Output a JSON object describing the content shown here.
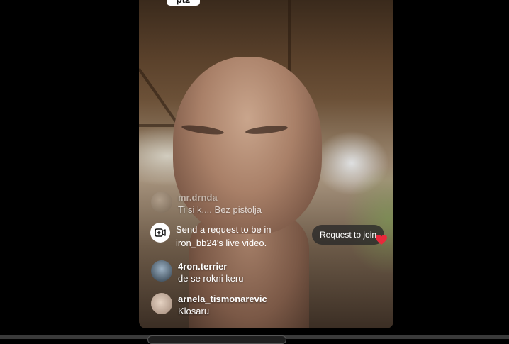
{
  "top_badge": {
    "label": "pt2"
  },
  "comments": [
    {
      "username": "mr.drnda",
      "message": "Ti si k.... Bez pistolja"
    },
    {
      "username": "4ron.terrier",
      "message": "de se rokni keru"
    },
    {
      "username": "arnela_tismonarevic",
      "message": "Klosaru"
    }
  ],
  "join_notice": {
    "icon": "video-camera-icon",
    "text": "Send a request to be in iron_bb24's live video."
  },
  "request_button": {
    "label": "Request to join"
  },
  "reaction": {
    "icon": "heart-icon",
    "color": "#e8293b"
  }
}
